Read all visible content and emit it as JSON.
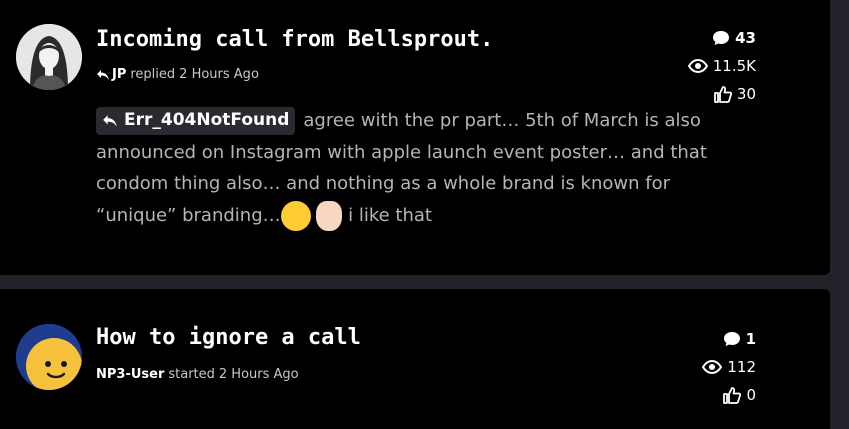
{
  "topics": [
    {
      "title": "Incoming call from Bellsprout.",
      "meta": {
        "user": "JP",
        "action": "replied",
        "time": "2 Hours Ago"
      },
      "stats": {
        "replies": "43",
        "views": "11.5K",
        "likes": "30"
      },
      "excerpt": {
        "quote_user": "Err_404NotFound",
        "text_before": "agree with the pr part… 5th of March is also announced on Instagram with apple launch event poster… and that condom thing also… and nothing as a whole brand is known for “unique” branding…",
        "emojis": [
          "face-with-tears-of-joy",
          "ok-hand"
        ],
        "text_after": "i like that"
      }
    },
    {
      "title": "How to ignore a call",
      "meta": {
        "user": "NP3-User",
        "action": "started",
        "time": "2 Hours Ago"
      },
      "stats": {
        "replies": "1",
        "views": "112",
        "likes": "0"
      }
    }
  ],
  "colors": {
    "card_bg": "#000000",
    "page_bg": "#22232a",
    "muted_text": "#b5b5b5",
    "chip_bg": "#2a2b31"
  }
}
